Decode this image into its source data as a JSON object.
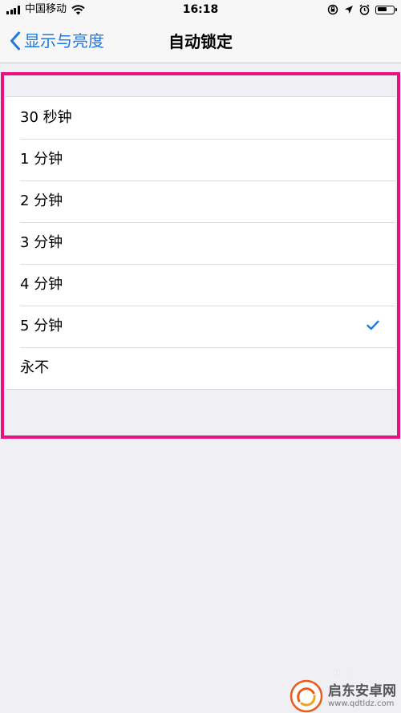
{
  "status_bar": {
    "carrier": "中国移动",
    "time": "16:18",
    "battery_level": 0.65
  },
  "nav": {
    "back_label": "显示与亮度",
    "title": "自动锁定"
  },
  "options": [
    {
      "label": "30 秒钟",
      "selected": false
    },
    {
      "label": "1 分钟",
      "selected": false
    },
    {
      "label": "2 分钟",
      "selected": false
    },
    {
      "label": "3 分钟",
      "selected": false
    },
    {
      "label": "4 分钟",
      "selected": false
    },
    {
      "label": "5 分钟",
      "selected": true
    },
    {
      "label": "永不",
      "selected": false
    }
  ],
  "colors": {
    "accent": "#1f7ae0",
    "highlight": "#e8117f",
    "background": "#efeff4"
  },
  "watermark": {
    "name": "启东安卓网",
    "url": "www.qdtldz.com"
  },
  "icons": [
    "signal-icon",
    "wifi-icon",
    "orientation-lock-icon",
    "location-icon",
    "alarm-icon",
    "battery-icon",
    "back-chevron-icon",
    "checkmark-icon",
    "watermark-logo-icon"
  ]
}
